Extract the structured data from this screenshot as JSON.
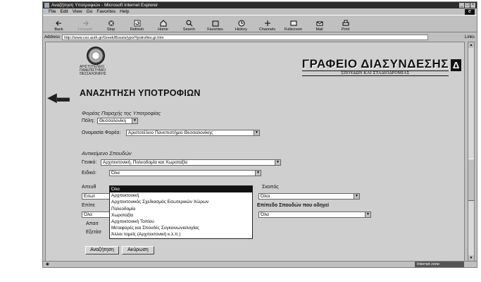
{
  "window": {
    "title": "Αναζήτηση Υποτροφιών - Microsoft Internet Explorer"
  },
  "menu": [
    "File",
    "Edit",
    "View",
    "Go",
    "Favorites",
    "Help"
  ],
  "toolbar": {
    "buttons": [
      {
        "label": "Back",
        "icon": "back-arrow-icon",
        "enabled": true
      },
      {
        "label": "Forward",
        "icon": "forward-arrow-icon",
        "enabled": false
      },
      {
        "label": "Stop",
        "icon": "stop-icon",
        "enabled": true
      },
      {
        "label": "Refresh",
        "icon": "refresh-icon",
        "enabled": true
      },
      {
        "label": "Home",
        "icon": "home-icon",
        "enabled": true
      },
      {
        "label": "Search",
        "icon": "search-icon",
        "enabled": true
      },
      {
        "label": "Favorites",
        "icon": "favorites-icon",
        "enabled": true
      },
      {
        "label": "History",
        "icon": "history-icon",
        "enabled": true
      },
      {
        "label": "Channels",
        "icon": "channels-icon",
        "enabled": true
      },
      {
        "label": "Fullscreen",
        "icon": "fullscreen-icon",
        "enabled": true
      },
      {
        "label": "Mail",
        "icon": "mail-icon",
        "enabled": true
      },
      {
        "label": "Print",
        "icon": "print-icon",
        "enabled": true
      }
    ]
  },
  "address": {
    "label": "Address",
    "url": "http://www.cso.auth.gr/Greek/Bossis/ypo/Ypotrofies.gr.htm",
    "links_label": "Links"
  },
  "header": {
    "university": "ΑΡΙΣΤΟΤΕΛΕΙΟ ΠΑΝΕΠΙΣΤΗΜΙΟ ΘΕΣΣΑΛΟΝΙΚΗΣ",
    "office_title": "ΓΡΑΦΕΙΟ ΔΙΑΣΥΝΔΕΣΗΣ",
    "office_subtitle": "ΣΠΟΥΔΩΝ ΚΑΙ ΣΤΑΔΙΟΔΡΟΜΙΑΣ",
    "office_logo_letter": "Δ"
  },
  "page_title": "ΑΝΑΖΗΤΗΣΗ ΥΠΟΤΡΟΦΙΩΝ",
  "provider": {
    "section_title": "Φορέας Παροχής της Υποτροφίας",
    "city_label": "Πόλη:",
    "city_value": "Θεσσαλονίκη",
    "name_label": "Ονομασία Φορέα:",
    "name_value": "Αριστοτέλειο Πανεπιστήμιο Θεσσαλονίκης"
  },
  "study": {
    "section_title": "Αντικείμενο Σπουδών",
    "general_label": "Γενικό:",
    "general_value": "Αρχιτεκτονική, Πολεοδομία και Χωροταξία",
    "specific_label": "Ειδικό:",
    "specific_value": "Όλα",
    "dropdown_options": [
      "Όλα",
      "Αρχιτεκτονική",
      "Αρχιτεκτονικός Σχεδιασμός Εσωτερικών Χώρων",
      "Πολεοδομία",
      "Χωροταξία",
      "Αρχιτεκτονική Τοπίου",
      "Μεταφορές και Σπουδές Συγκοινωνιολογίας",
      "Άλλοι τομείς (Αρχιτεκτονική κ.λ.π.)"
    ],
    "selected_index": 0
  },
  "partial_labels": {
    "targeted_label": "Απευθ",
    "targeted_value": "Εσωτ",
    "purpose_label": "Σκοπός",
    "purpose_value": "Όλοι",
    "level_label": "Επίπε",
    "level_value": "Όλα",
    "degree_label": "Επίπεδο Σπουδών που οδηγεί",
    "degree_value": "Όλα",
    "required_label": "Απαιτ",
    "exams_label": "Εξετάσ"
  },
  "buttons": {
    "search": "Αναζήτηση",
    "cancel": "Ακύρωση"
  },
  "status": {
    "zone": "Internet zone"
  }
}
